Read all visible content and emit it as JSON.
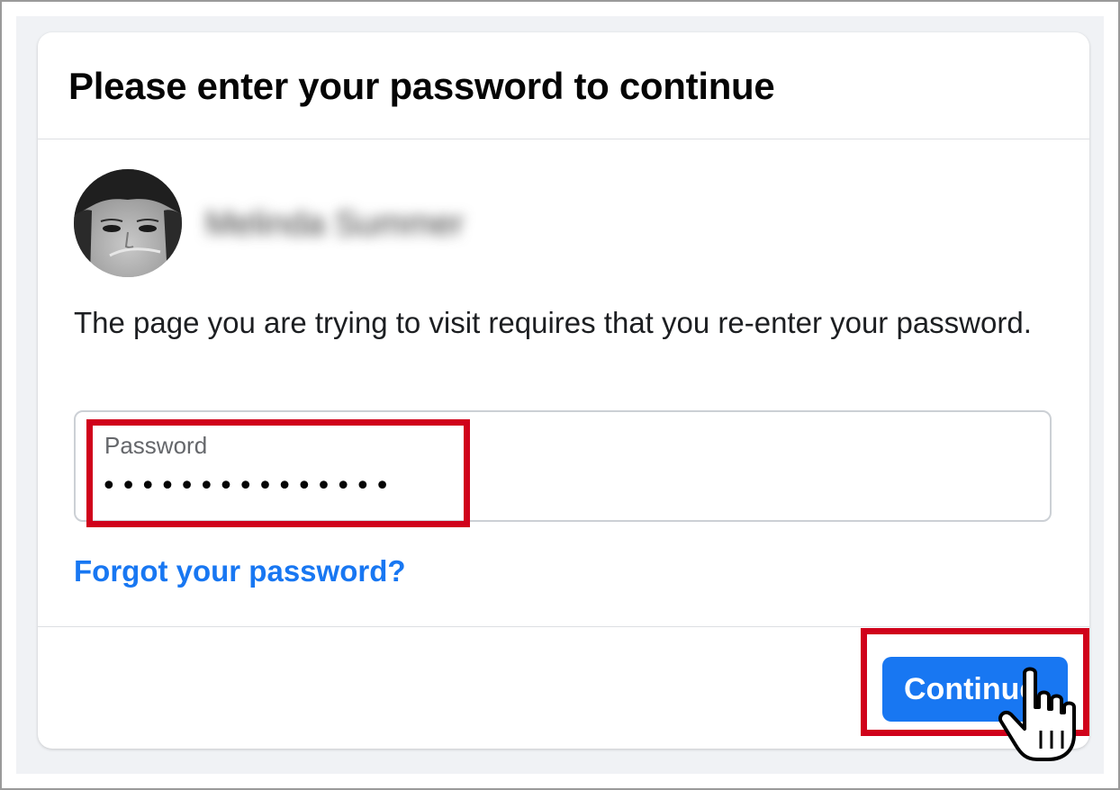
{
  "dialog": {
    "title": "Please enter your password to continue",
    "user_name": "Melinda Summer",
    "message": "The page you are trying to visit requires that you re-enter your password."
  },
  "password_field": {
    "label": "Password",
    "value": "123456789012345"
  },
  "links": {
    "forgot_password": "Forgot your password?"
  },
  "buttons": {
    "continue_label": "Continue"
  },
  "colors": {
    "accent": "#1877f2",
    "highlight": "#d0021b",
    "backdrop": "#f0f2f5"
  },
  "icons": {
    "cursor": "hand-pointer-icon"
  }
}
